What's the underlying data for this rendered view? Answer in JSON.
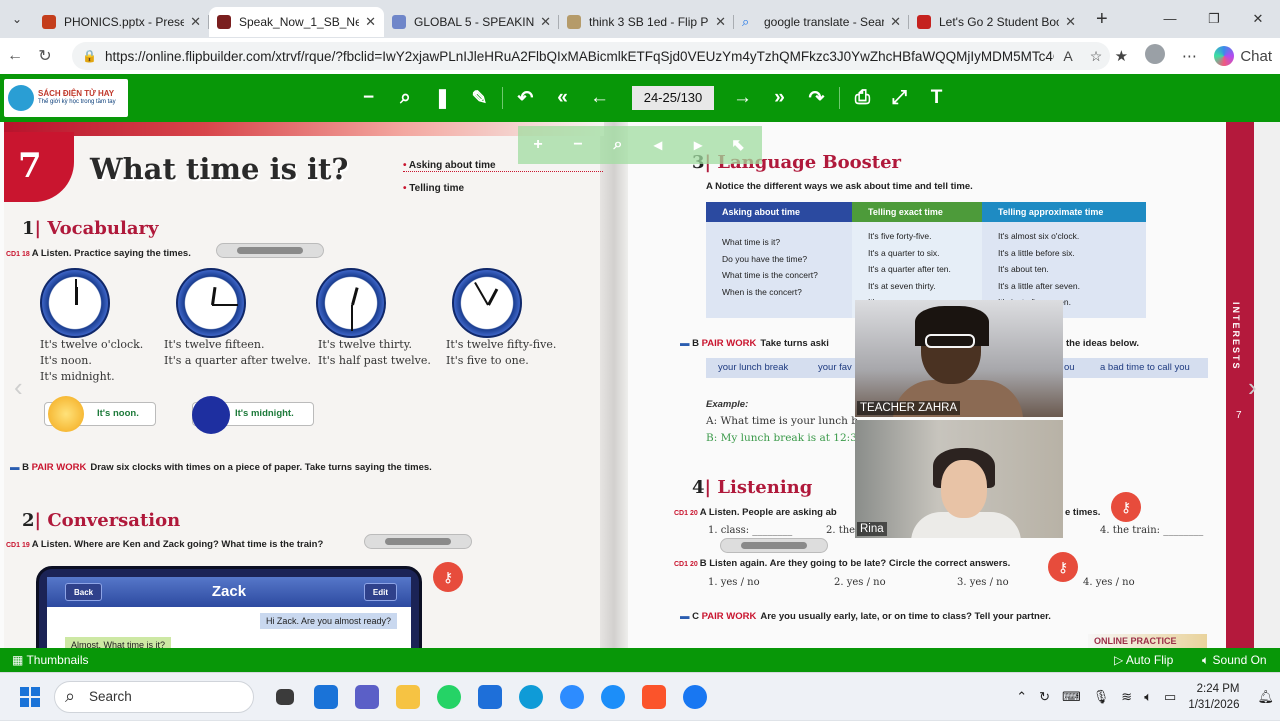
{
  "browser": {
    "tabs": [
      {
        "title": "PHONICS.pptx - Present",
        "color": "#c43e1c"
      },
      {
        "title": "Speak_Now_1_SB_Neat",
        "color": "#7a1f1f"
      },
      {
        "title": "GLOBAL 5 - SPEAKING -",
        "color": "#6f86c9"
      },
      {
        "title": "think 3 SB 1ed - Flip PDF",
        "color": "#b59b6a"
      },
      {
        "title": "google translate - Search",
        "color": "#1a73e8"
      },
      {
        "title": "Let's Go 2 Student Book",
        "color": "#c5221f"
      }
    ],
    "url": "https://online.flipbuilder.com/xtrvf/rque/?fbclid=IwY2xjawPLnIJleHRuA2FlbQIxMABicmlkETFqSjd0VEUzYm4yTzhQMFkzc3J0YwZhcHBfaWQQMjIyMDM5MTc4ODIw...",
    "chat_label": "Chat"
  },
  "flipbook": {
    "logo_title": "SÁCH ĐIỆN TỬ HAY",
    "logo_sub": "Thế giới kỳ học trong tầm tay",
    "page_indicator": "24-25/130",
    "thumbnails_label": "Thumbnails",
    "autoflip_label": "Auto Flip",
    "sound_label": "Sound On"
  },
  "left_page": {
    "unit_number": "7",
    "title": "What time is it?",
    "topics": [
      "Asking about time",
      "Telling time"
    ],
    "vocab_num": "1",
    "vocab_title": "Vocabulary",
    "vocab_cd": "CD1 18",
    "vocab_inst": "A  Listen. Practice saying the times.",
    "clocks": [
      {
        "text": [
          "It's twelve o'clock.",
          "It's noon.",
          "It's midnight."
        ],
        "hour_deg": 0,
        "min_deg": 0
      },
      {
        "text": [
          "It's twelve fifteen.",
          "It's a quarter after twelve."
        ],
        "hour_deg": 8,
        "min_deg": 90
      },
      {
        "text": [
          "It's twelve thirty.",
          "It's half past twelve."
        ],
        "hour_deg": 15,
        "min_deg": 180
      },
      {
        "text": [
          "It's twelve fifty-five.",
          "It's five to one."
        ],
        "hour_deg": 28,
        "min_deg": 330
      }
    ],
    "noon_bubble": "It's noon.",
    "midnight_bubble": "It's midnight.",
    "pairwork_b": "B",
    "pairwork_label": "PAIR WORK",
    "pairwork_text": "Draw six clocks with times on a piece of paper. Take turns saying the times.",
    "conv_num": "2",
    "conv_title": "Conversation",
    "conv_cd": "CD1 19",
    "conv_inst": "A  Listen. Where are Ken and Zack going? What time is the train?",
    "phone_title": "Zack",
    "phone_back": "Back",
    "phone_edit": "Edit",
    "msg1": "Hi Zack. Are you almost ready?",
    "msg2": "Almost. What time is it?"
  },
  "right_page": {
    "lb_num": "3",
    "lb_title": "Language Booster",
    "lb_inst": "A  Notice the different ways we ask about time and tell time.",
    "columns": [
      {
        "header": "Asking about time",
        "color": "#2b4aa0",
        "lines": [
          "What time is it?",
          "Do you have the time?",
          "What time is the concert?",
          "When is the concert?"
        ]
      },
      {
        "header": "Telling exact time",
        "color": "#4d9b3a",
        "lines": [
          "It's five forty-five.",
          "It's a quarter to six.",
          "It's a quarter after ten.",
          "It's at seven thirty.",
          "It's ..."
        ]
      },
      {
        "header": "Telling approximate time",
        "color": "#1e8bc3",
        "lines": [
          "It's almost six o'clock.",
          "It's a little before six.",
          "It's about ten.",
          "It's a little after seven.",
          "It's just after seven."
        ]
      }
    ],
    "pw_b": "B",
    "pw_label": "PAIR WORK",
    "pw_text": "Take turns aski",
    "pw_text_end": "the ideas below.",
    "ideas": [
      "your lunch break",
      "your fav",
      "ou",
      "a bad time to call you"
    ],
    "example_label": "Example:",
    "example_a": "A:  What time is your lunch b",
    "example_b": "B:  My lunch break is at 12:30",
    "listen_num": "4",
    "listen_title": "Listening",
    "listen_cd": "CD1 20",
    "listen_inst": "A  Listen. People are asking ab",
    "listen_inst_end": "e times.",
    "listen_items": [
      "1. class: ________",
      "2. the",
      "4. the train: ________"
    ],
    "listen_b_cd": "CD1 20",
    "listen_b": "B  Listen again. Are they going to be late? Circle the correct answers.",
    "answers": [
      "1. yes / no",
      "2. yes / no",
      "3. yes / no",
      "4. yes / no"
    ],
    "pw_c": "C",
    "pw_c_label": "PAIR WORK",
    "pw_c_text": "Are you usually early, late, or on time to class? Tell your partner.",
    "online": "ONLINE PRACTICE",
    "side_label": "INTERESTS",
    "side_page": "7"
  },
  "video": {
    "teacher": "TEACHER ZAHRA",
    "student": "Rina"
  },
  "taskbar": {
    "search_placeholder": "Search",
    "time": "2:24 PM",
    "date": "1/31/2026"
  }
}
